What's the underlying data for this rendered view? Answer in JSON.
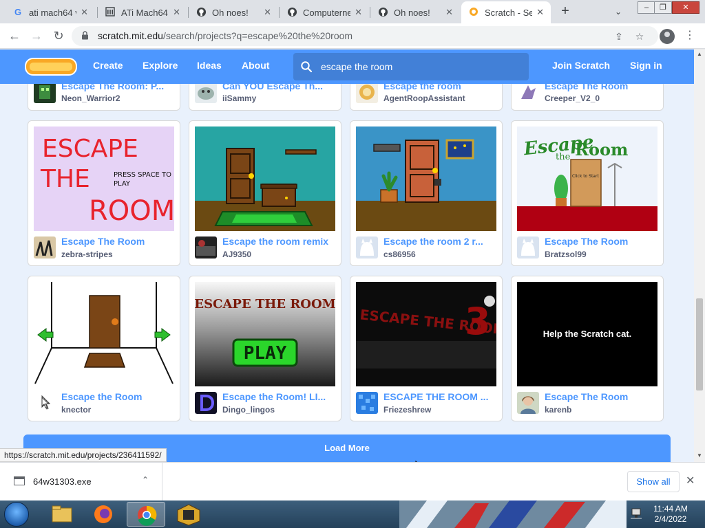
{
  "browser": {
    "tabs": [
      {
        "label": "ati mach64 v",
        "icon": "google-icon"
      },
      {
        "label": "ATi Mach64 /",
        "icon": "museum-icon"
      },
      {
        "label": "Oh noes!",
        "icon": "github-icon"
      },
      {
        "label": "Computerne",
        "icon": "github-icon"
      },
      {
        "label": "Oh noes!",
        "icon": "github-icon"
      },
      {
        "label": "Scratch - Se",
        "icon": "scratch-icon",
        "active": true
      }
    ],
    "new_tab": "+",
    "url_host": "scratch.mit.edu",
    "url_path": "/search/projects?q=escape%20the%20room"
  },
  "scratch_nav": {
    "links": [
      "Create",
      "Explore",
      "Ideas",
      "About"
    ],
    "search_value": "escape the room",
    "join": "Join Scratch",
    "signin": "Sign in"
  },
  "projects": {
    "partial_row": [
      {
        "title": "Escape The Room: P...",
        "author": "Neon_Warrior2"
      },
      {
        "title": "Can YOU Escape Th...",
        "author": "iiSammy"
      },
      {
        "title": "Escape the room",
        "author": "AgentRoopAssistant"
      },
      {
        "title": "Escape The Room",
        "author": "Creeper_V2_0"
      }
    ],
    "row1": [
      {
        "title": "Escape The Room",
        "author": "zebra-stripes"
      },
      {
        "title": "Escape the room remix",
        "author": "AJ9350"
      },
      {
        "title": "Escape the room 2 r...",
        "author": "cs86956"
      },
      {
        "title": "Escape The Room",
        "author": "Bratzsol99"
      }
    ],
    "row2": [
      {
        "title": "Escape the Room",
        "author": "knector"
      },
      {
        "title": "Escape the Room! LI...",
        "author": "Dingo_lingos"
      },
      {
        "title": "ESCAPE THE ROOM ...",
        "author": "Friezeshrew"
      },
      {
        "title": "Escape The Room",
        "author": "karenb"
      }
    ]
  },
  "thumbs": {
    "t1_line1": "ESCAPE",
    "t1_line2": "THE",
    "t1_line3": "ROOM",
    "t1_press": "PRESS SPACE TO",
    "t1_play": "PLAY",
    "t4_escape": "Escape",
    "t4_the": "the",
    "t4_room": "Room",
    "t4_click": "Click to Start",
    "t6_title": "ESCAPE THE ROOM",
    "t6_play": "PLAY",
    "t7_text": "ESCAPE THE ROOM",
    "t7_num": "3",
    "t8_text": "Help the Scratch cat."
  },
  "load_more": "Load More",
  "status_url": "https://scratch.mit.edu/projects/236411592/",
  "downloads": {
    "file": "64w31303.exe",
    "show_all": "Show all"
  },
  "taskbar": {
    "time": "11:44 AM",
    "date": "2/4/2022"
  }
}
